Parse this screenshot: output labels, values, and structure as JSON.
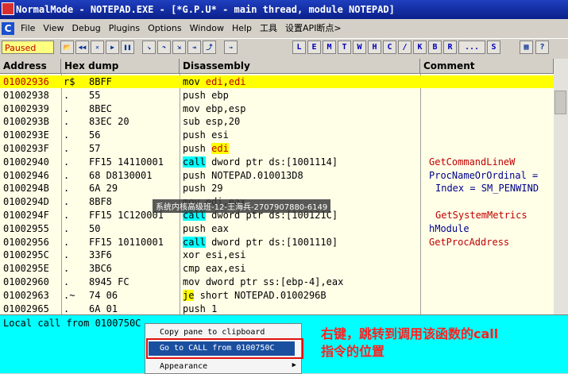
{
  "window": {
    "title": "NormalMode - NOTEPAD.EXE - [*G.P.U* - main thread, module NOTEPAD]"
  },
  "menu": {
    "items": [
      "File",
      "View",
      "Debug",
      "Plugins",
      "Options",
      "Window",
      "Help",
      "工具",
      "设置API断点>"
    ]
  },
  "toolbar": {
    "status": "Paused",
    "buttons": [
      "open",
      "rewind",
      "close",
      "run",
      "pause",
      "step-into",
      "step-over",
      "trace-into",
      "trace-over",
      "execute-till-return",
      "goto"
    ],
    "letters": [
      "L",
      "E",
      "M",
      "T",
      "W",
      "H",
      "C",
      "/",
      "K",
      "B",
      "R",
      "...",
      "S"
    ]
  },
  "columns": [
    "Address",
    "Hex dump",
    "Disassembly",
    "Comment"
  ],
  "rows": [
    {
      "addr": "01002936",
      "mark": "r$",
      "hex": "8BFF",
      "dis": "mov edi,edi",
      "comment": ""
    },
    {
      "addr": "01002938",
      "mark": ".",
      "hex": "55",
      "dis": "push ebp",
      "comment": ""
    },
    {
      "addr": "01002939",
      "mark": ".",
      "hex": "8BEC",
      "dis": "mov ebp,esp",
      "comment": ""
    },
    {
      "addr": "0100293B",
      "mark": ".",
      "hex": "83EC 20",
      "dis": "sub esp,20",
      "comment": ""
    },
    {
      "addr": "0100293E",
      "mark": ".",
      "hex": "56",
      "dis": "push esi",
      "comment": ""
    },
    {
      "addr": "0100293F",
      "mark": ".",
      "hex": "57",
      "dis": "push edi",
      "comment": ""
    },
    {
      "addr": "01002940",
      "mark": ".",
      "hex": "FF15 14110001",
      "dis": "call dword ptr ds:[1001114]",
      "comment": "GetCommandLineW"
    },
    {
      "addr": "01002946",
      "mark": ".",
      "hex": "68 D8130001",
      "dis": "push NOTEPAD.010013D8",
      "comment": "ProcNameOrOrdinal ="
    },
    {
      "addr": "0100294B",
      "mark": ".",
      "hex": "6A 29",
      "dis": "push 29",
      "comment": "Index = SM_PENWIND"
    },
    {
      "addr": "0100294D",
      "mark": ".",
      "hex": "8BF8",
      "dis": "mov edi,eax",
      "comment": ""
    },
    {
      "addr": "0100294F",
      "mark": ".",
      "hex": "FF15 1C120001",
      "dis": "call dword ptr ds:[100121C]",
      "comment": "GetSystemMetrics"
    },
    {
      "addr": "01002955",
      "mark": ".",
      "hex": "50",
      "dis": "push eax",
      "comment": "hModule"
    },
    {
      "addr": "01002956",
      "mark": ".",
      "hex": "FF15 10110001",
      "dis": "call dword ptr ds:[1001110]",
      "comment": "GetProcAddress"
    },
    {
      "addr": "0100295C",
      "mark": ".",
      "hex": "33F6",
      "dis": "xor esi,esi",
      "comment": ""
    },
    {
      "addr": "0100295E",
      "mark": ".",
      "hex": "3BC6",
      "dis": "cmp eax,esi",
      "comment": ""
    },
    {
      "addr": "01002960",
      "mark": ".",
      "hex": "8945 FC",
      "dis": "mov dword ptr ss:[ebp-4],eax",
      "comment": ""
    },
    {
      "addr": "01002963",
      "mark": ".~",
      "hex": "74 06",
      "dis": "je short NOTEPAD.0100296B",
      "comment": ""
    },
    {
      "addr": "01002965",
      "mark": ".",
      "hex": "6A 01",
      "dis": "push 1",
      "comment": ""
    }
  ],
  "info": {
    "text": "Local call from 0100750C"
  },
  "context_menu": {
    "items": [
      "Copy pane to clipboard",
      "Go to CALL from 0100750C",
      "Appearance"
    ]
  },
  "annotation": {
    "line1": "右键，跳转到调用该函数的call",
    "line2": "指令的位置"
  },
  "watermark": "系统内核高级班-12-王海兵-2707907880-6149",
  "colors": {
    "selection": "#ffff00",
    "call": "#00ffff",
    "info_pane": "#00ffff",
    "annotation": "#ff2020"
  }
}
